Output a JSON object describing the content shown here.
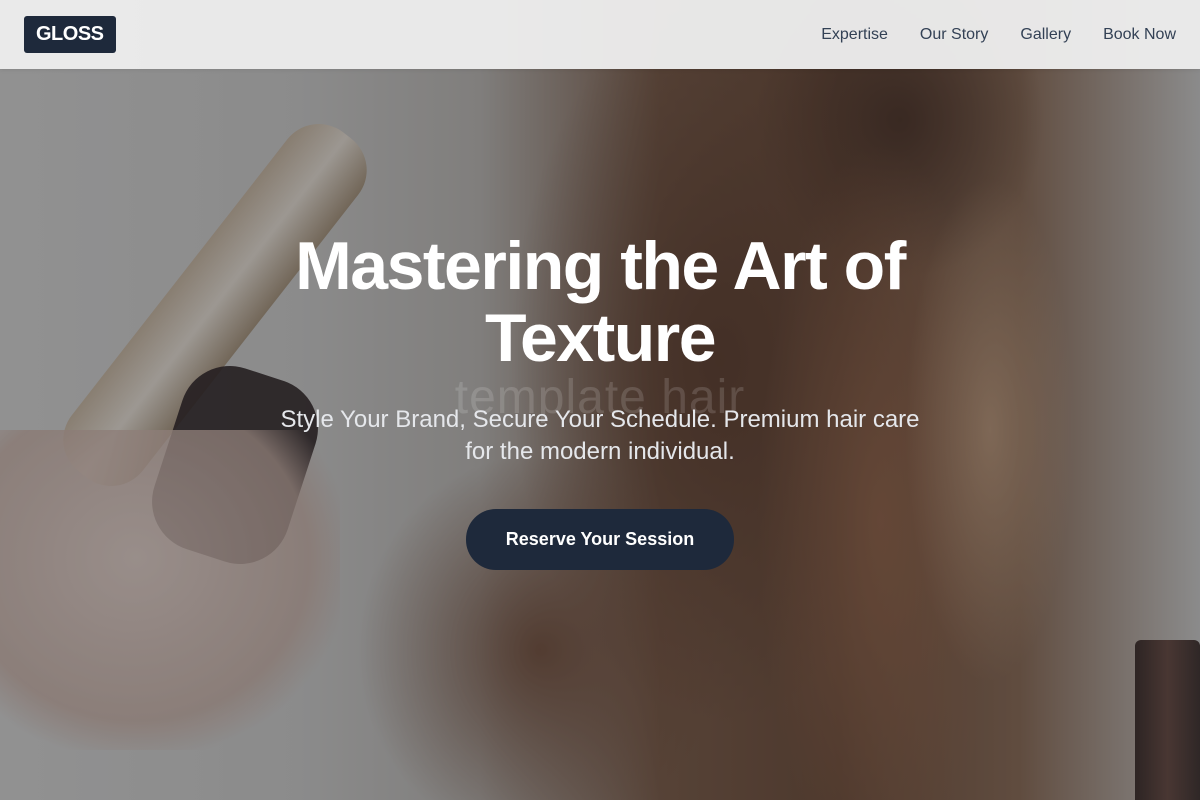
{
  "brand": {
    "logo": "GLOSS"
  },
  "nav": {
    "items": [
      {
        "label": "Expertise"
      },
      {
        "label": "Our Story"
      },
      {
        "label": "Gallery"
      },
      {
        "label": "Book Now"
      }
    ]
  },
  "hero": {
    "title": "Mastering the Art of Texture",
    "watermark": "template hair",
    "subtitle": "Style Your Brand, Secure Your Schedule. Premium hair care for the modern individual.",
    "cta_label": "Reserve Your Session"
  },
  "colors": {
    "accent": "#1e293b",
    "nav_text": "#334155",
    "nav_bg": "#ececec"
  }
}
